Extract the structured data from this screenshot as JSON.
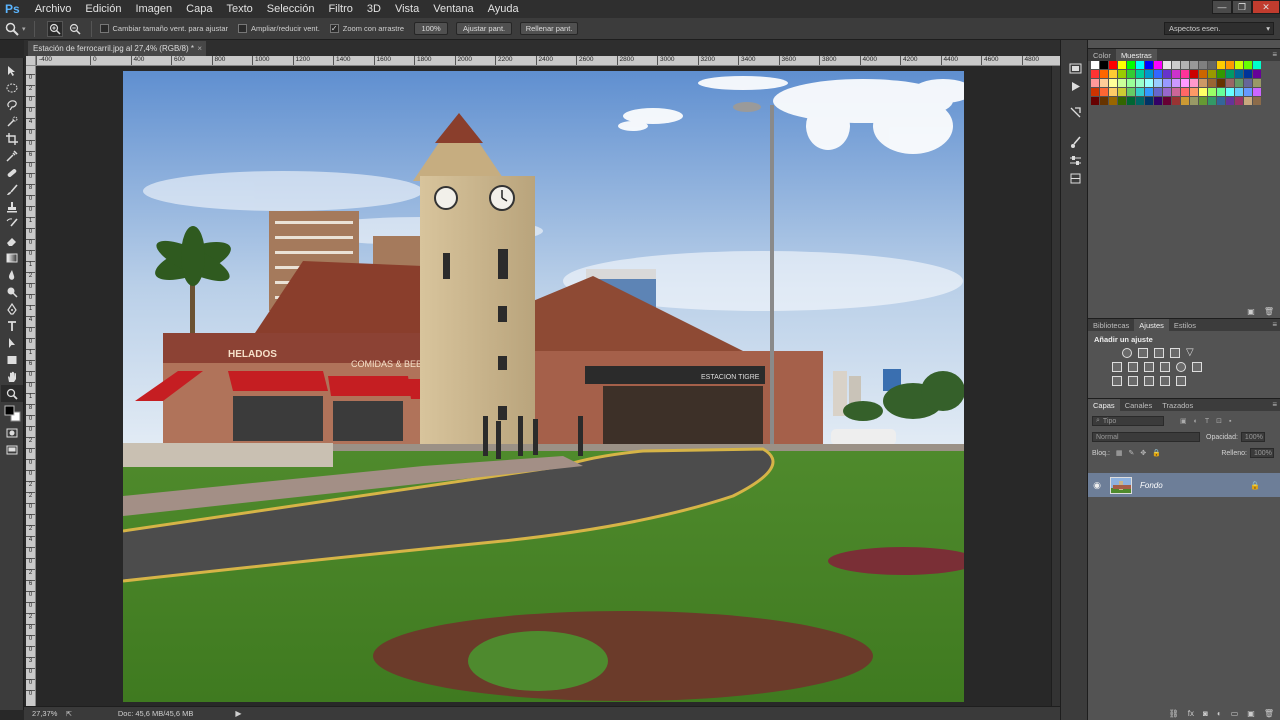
{
  "app": {
    "logo": "Ps",
    "menus": [
      "Archivo",
      "Edición",
      "Imagen",
      "Capa",
      "Texto",
      "Selección",
      "Filtro",
      "3D",
      "Vista",
      "Ventana",
      "Ayuda"
    ],
    "window_controls": [
      "—",
      "❐",
      "✕"
    ]
  },
  "options_bar": {
    "tool_icon": "zoom-icon",
    "chk_resize": {
      "label": "Cambiar tamaño vent. para ajustar",
      "checked": false
    },
    "chk_zoom_all": {
      "label": "Ampliar/reducir vent.",
      "checked": false
    },
    "chk_scrubby": {
      "label": "Zoom con arrastre",
      "checked": true
    },
    "zoom_value": "100%",
    "fit_screen": "Ajustar pant.",
    "fill_screen": "Rellenar pant.",
    "workspace": "Aspectos esen."
  },
  "document": {
    "tab_title": "Estación de ferrocarril.jpg al 27,4% (RGB/8) *",
    "ruler_h": [
      "0",
      "400",
      "600",
      "800",
      "1000",
      "1200",
      "1400",
      "1600",
      "1800",
      "2000",
      "2200",
      "2400",
      "2600",
      "2800",
      "3000",
      "3200",
      "3400",
      "3600",
      "3800",
      "4000",
      "4200",
      "4400",
      "4600",
      "4800",
      "5000"
    ],
    "ruler_h_prefix": "-400",
    "ruler_v": [
      "0",
      "2",
      "0",
      "0",
      "4",
      "0",
      "0",
      "6",
      "0",
      "0",
      "8",
      "0",
      "0",
      "1",
      "0",
      "0",
      "0",
      "1",
      "2",
      "0",
      "0",
      "1",
      "4",
      "0",
      "0",
      "1",
      "6",
      "0",
      "0",
      "1",
      "8",
      "0",
      "0",
      "2",
      "0",
      "0",
      "0",
      "2",
      "2",
      "0",
      "0",
      "2",
      "4",
      "0",
      "0",
      "2",
      "6",
      "0",
      "0",
      "2",
      "8",
      "0",
      "0",
      "3",
      "0",
      "0",
      "0"
    ],
    "photo_text": {
      "sign_main": "COMIDAS & BEBIDAS",
      "sign_left": "HELADOS",
      "station_label": "ESTACION  TIGRE"
    }
  },
  "status": {
    "zoom": "27,37%",
    "doc_info": "Doc: 45,6 MB/45,6 MB"
  },
  "panels": {
    "color_tabs": [
      "Color",
      "Muestras"
    ],
    "adjust_tabs": [
      "Bibliotecas",
      "Ajustes",
      "Estilos"
    ],
    "adjust_title": "Añadir un ajuste",
    "layers_tabs": [
      "Capas",
      "Canales",
      "Trazados"
    ],
    "filter_kind": "Tipo",
    "blend_mode": "Normal",
    "opacity_label": "Opacidad:",
    "opacity_value": "100%",
    "lock_label": "Bloq.:",
    "fill_label": "Relleno:",
    "fill_value": "100%",
    "layer_name": "Fondo"
  },
  "swatch_colors": [
    "#ffffff",
    "#000000",
    "#ff0000",
    "#ffff00",
    "#00ff00",
    "#00ffff",
    "#0000ff",
    "#ff00ff",
    "#e6e6e6",
    "#cccccc",
    "#b3b3b3",
    "#999999",
    "#808080",
    "#666666",
    "#ffcc00",
    "#ff9900",
    "#ccff00",
    "#66ff00",
    "#00ffcc",
    "#ff3333",
    "#ff6600",
    "#ffcc33",
    "#99cc00",
    "#33cc33",
    "#00cc99",
    "#0099cc",
    "#3366ff",
    "#6633cc",
    "#cc33cc",
    "#ff3399",
    "#cc0000",
    "#cc6600",
    "#999900",
    "#339900",
    "#009966",
    "#006699",
    "#003399",
    "#660099",
    "#ff9999",
    "#ffcc99",
    "#ffff99",
    "#ccff99",
    "#99ff99",
    "#99ffcc",
    "#99ffff",
    "#99ccff",
    "#9999ff",
    "#cc99ff",
    "#ff99ff",
    "#ff99cc",
    "#cc9966",
    "#996633",
    "#663300",
    "#996666",
    "#669966",
    "#666699",
    "#999966",
    "#cc3300",
    "#ff6633",
    "#ffcc66",
    "#cccc33",
    "#66cc66",
    "#33cccc",
    "#3399ff",
    "#6666cc",
    "#9966cc",
    "#cc6699",
    "#ff6666",
    "#ff9966",
    "#ffff66",
    "#99ff66",
    "#66ff99",
    "#66ffff",
    "#66ccff",
    "#6699ff",
    "#cc66ff",
    "#660000",
    "#663300",
    "#996600",
    "#336600",
    "#006633",
    "#006666",
    "#003366",
    "#330066",
    "#660033",
    "#993333",
    "#cc9933",
    "#999966",
    "#669933",
    "#339966",
    "#336699",
    "#663399",
    "#993366",
    "#c8a97e",
    "#8b6b4a"
  ]
}
